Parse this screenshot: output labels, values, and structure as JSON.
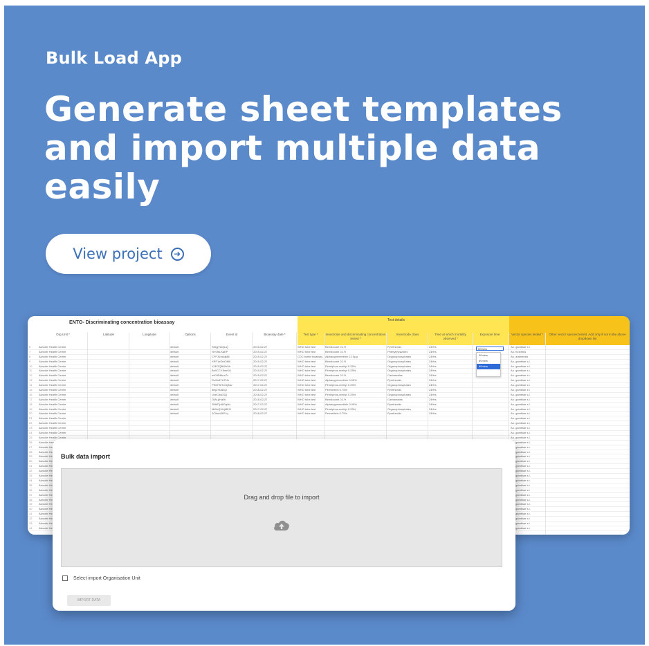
{
  "header": {
    "app_name": "Bulk Load App",
    "headline": "Generate sheet templates and import multiple data easily",
    "cta_label": "View project",
    "cta_icon": "arrow-circle-right-icon"
  },
  "colors": {
    "background": "#5b8acb",
    "header_yellow": "#ffe552",
    "header_orange": "#f7c21a",
    "selection_blue": "#2f6bd8"
  },
  "sheet": {
    "title": "ENTO- Discriminating concentration bioassay",
    "group_header": "Test details",
    "columns": [
      "Org Unit *",
      "Latitude",
      "Longitude",
      "Options",
      "Event id",
      "Bioassay date *",
      "Test type *",
      "Insecticide and discriminating concentration tested *",
      "Insecticide class",
      "Time at which mortality observed *",
      "Exposure time",
      "Vector species tested *",
      "Other vector species tested. Add only if not in the above dropdown list"
    ],
    "selected_cell": "60mins",
    "dropdown_options": [
      "30mins",
      "60mins",
      "60mins"
    ],
    "rows": [
      [
        "Akrodie Health Centre",
        "default",
        "SiSgjYAGjuQ",
        "2019-02-27",
        "WHO tube test",
        "Bendiocarb 0.1%",
        "Pyrethroids",
        "24Hrs",
        "An. gambiae s.l."
      ],
      [
        "Akrodie Health Centre",
        "default",
        "NY0fkLKaEP",
        "2019-02-27",
        "WHO tube test",
        "Bendiocarb 0.1%",
        "Phenylpyrazoles",
        "24Hrs",
        "An. funestus"
      ],
      [
        "Akrodie Health Centre",
        "default",
        "CFFJKnAqkBb",
        "2019-02-27",
        "CDC bottle bioassay",
        "Alphacypermethrin 12.5µg",
        "Organophosphates",
        "24Hrs",
        "An. arabiensis"
      ],
      [
        "Akrodie Health Centre",
        "default",
        "XRF1eDeiOM0",
        "2019-02-27",
        "WHO tube test",
        "Bendiocarb 0.1%",
        "Organophosphates",
        "24Hrs",
        "An. gambiae s.l."
      ],
      [
        "Akrodie Health Centre",
        "default",
        "XJEGQBWhUb",
        "2019-02-27",
        "WHO tube test",
        "Pirimiphos-methyl 0.25%",
        "Organophosphates",
        "24Hrs",
        "An. gambiae s.l."
      ],
      [
        "Akrodie Health Centre",
        "default",
        "Bn0CCY8mrKU",
        "2019-02-27",
        "WHO tube test",
        "Pirimiphos-methyl 0.25%",
        "Organophosphates",
        "24Hrs",
        "An. gambiae s.l."
      ],
      [
        "Akrodie Health Centre",
        "default",
        "mKHDMrru7z",
        "2019-02-27",
        "WHO tube test",
        "Bendiocarb 0.1%",
        "Carbamates",
        "24Hrs",
        "An. gambiae s.l."
      ],
      [
        "Akrodie Health Centre",
        "default",
        "RzXb8YHf7Jk",
        "2017-02-27",
        "WHO tube test",
        "Alphacypermethrin 0.05%",
        "Pyrethroids",
        "24Hrs",
        "An. gambiae s.l."
      ],
      [
        "Akrodie Health Centre",
        "default",
        "PSDF8ITz0QNw",
        "2017-02-27",
        "WHO tube test",
        "Pirimiphos-methyl 0.25%",
        "Organophosphates",
        "24Hrs",
        "An. gambiae s.l."
      ],
      [
        "Akrodie Health Centre",
        "default",
        "aNj2XDtkxjJ",
        "2018-02-27",
        "WHO tube test",
        "Permethrin 0.75%",
        "Pyrethroids",
        "24Hrs",
        "An. gambiae s.l."
      ],
      [
        "Akrodie Health Centre",
        "default",
        "UxeCtkd2Qjl",
        "2018-02-27",
        "WHO tube test",
        "Pirimiphos-methyl 0.25%",
        "Organophosphates",
        "24Hrs",
        "An. gambiae s.l."
      ],
      [
        "Akrodie Health Centre",
        "default",
        "OtALjtHa9k",
        "2018-02-27",
        "WHO tube test",
        "Bendiocarb 0.1%",
        "Carbamates",
        "24Hrs",
        "An. gambiae s.l."
      ],
      [
        "Akrodie Health Centre",
        "default",
        "2MMTpf6GqHz",
        "2017-02-27",
        "WHO tube test",
        "Alphacypermethrin 0.05%",
        "Pyrethroids",
        "24Hrs",
        "An. gambiae s.l."
      ],
      [
        "Akrodie Health Centre",
        "default",
        "MWoQXHjMKH",
        "2017-02-27",
        "WHO tube test",
        "Pirimiphos-methyl 0.25%",
        "Organophosphates",
        "24Hrs",
        "An. gambiae s.l."
      ],
      [
        "Akrodie Health Centre",
        "default",
        "2ClkuhDtP1q",
        "2018-02-27",
        "WHO tube test",
        "Permethrin 0.75%",
        "Pyrethroids",
        "24Hrs",
        "An. gambiae s.l."
      ]
    ],
    "extra_rows": 24,
    "extra_row_org": "Akrodie Health Centre",
    "extra_row_species": "An. gambiae s.l."
  },
  "import_dialog": {
    "title": "Bulk data import",
    "dropzone_text": "Drag and drop file to import",
    "dropzone_icon": "cloud-upload-icon",
    "checkbox_label": "Select import Organisation Unit",
    "import_button": "IMPORT DATA"
  }
}
